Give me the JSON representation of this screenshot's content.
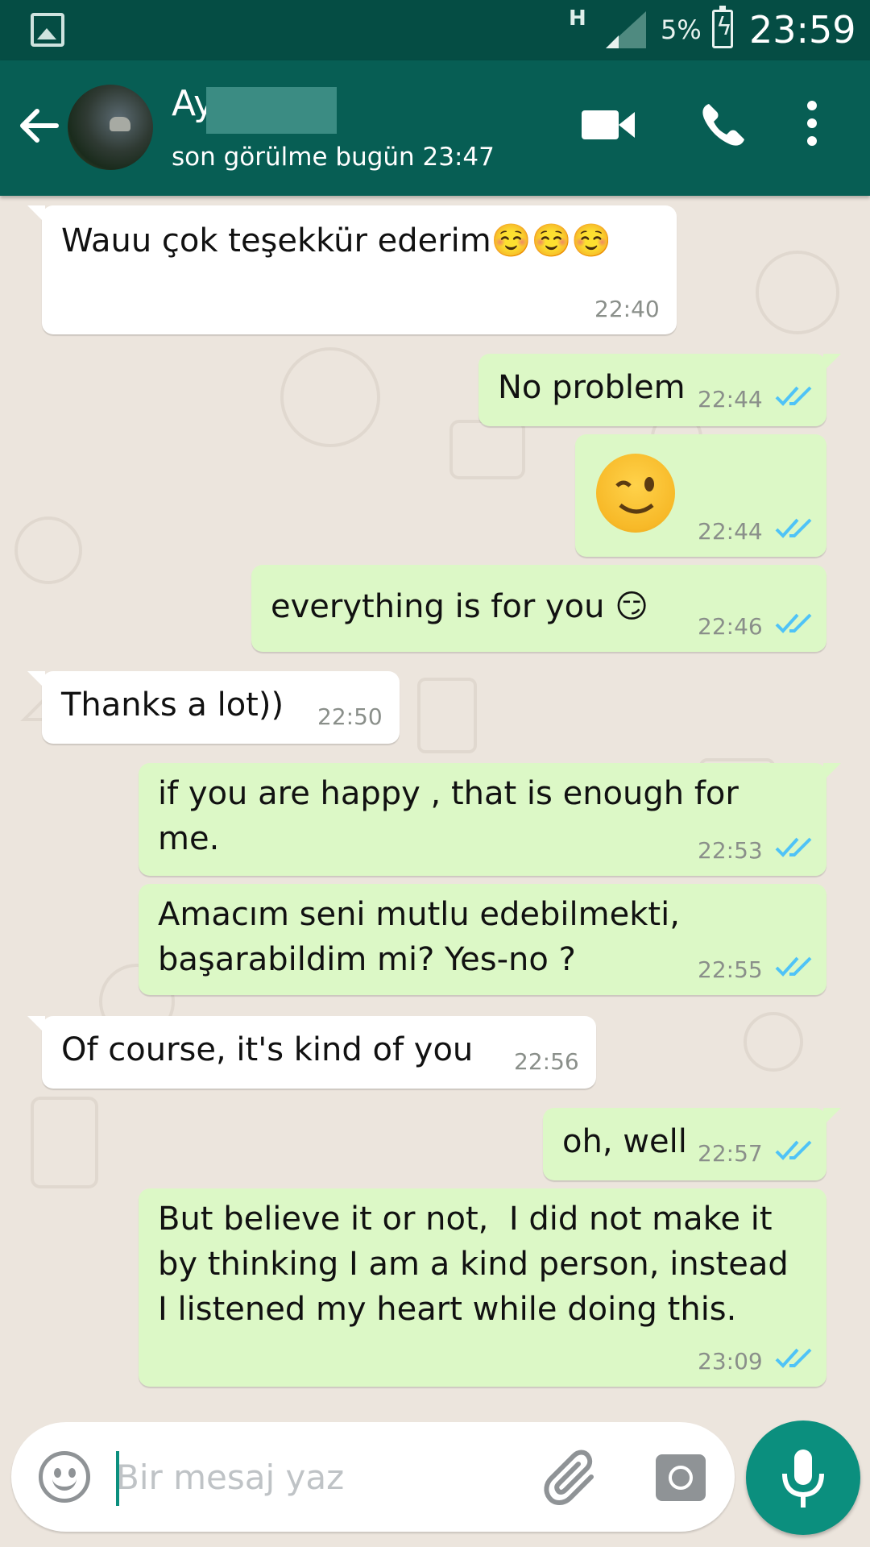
{
  "status_bar": {
    "network": "H",
    "battery": "5%",
    "time": "23:59"
  },
  "header": {
    "contact_name": "Ay",
    "last_seen": "son görülme bugün 23:47"
  },
  "messages": [
    {
      "dir": "in",
      "text": "Wauu çok teşekkür ederim☺️☺️☺️",
      "time": "22:40"
    },
    {
      "dir": "out",
      "text": "No problem",
      "time": "22:44",
      "status": "read"
    },
    {
      "dir": "out",
      "text": "😉",
      "time": "22:44",
      "status": "read"
    },
    {
      "dir": "out",
      "text": "everything is for you 😏",
      "time": "22:46",
      "status": "read"
    },
    {
      "dir": "in",
      "text": "Thanks a lot))",
      "time": "22:50"
    },
    {
      "dir": "out",
      "text": "if you are happy , that is enough for me.",
      "time": "22:53",
      "status": "read"
    },
    {
      "dir": "out",
      "text": "Amacım seni mutlu edebilmekti, başarabildim mi? Yes-no ?",
      "time": "22:55",
      "status": "read"
    },
    {
      "dir": "in",
      "text": "Of course, it's kind of you",
      "time": "22:56"
    },
    {
      "dir": "out",
      "text": "oh, well",
      "time": "22:57",
      "status": "read"
    },
    {
      "dir": "out",
      "text": "But believe it or not,  I did not make it by thinking I am a kind person, instead I listened my heart while doing this.",
      "time": "23:09",
      "status": "read"
    }
  ],
  "composer": {
    "placeholder": "Bir mesaj yaz"
  },
  "colors": {
    "status_bar": "#054d44",
    "header": "#075e54",
    "outgoing_bubble": "#dcf8c6",
    "incoming_bubble": "#ffffff",
    "chat_background": "#ece5dd",
    "read_ticks": "#4fc3f7",
    "mic_button": "#0b8f7e"
  },
  "icons": [
    "gallery-icon",
    "signal-icon",
    "battery-icon",
    "back-arrow-icon",
    "video-call-icon",
    "phone-icon",
    "more-vert-icon",
    "emoji-icon",
    "attach-icon",
    "camera-icon",
    "mic-icon",
    "double-check-icon"
  ]
}
